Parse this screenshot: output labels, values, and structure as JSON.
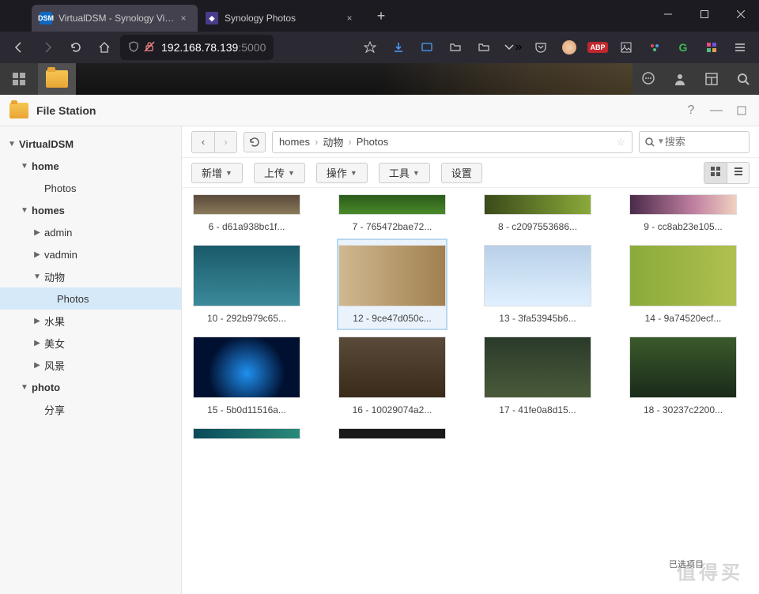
{
  "browser": {
    "tabs": [
      {
        "title": "VirtualDSM - Synology Virtua",
        "favicon_bg": "#1068bf",
        "favicon_txt": "DSM",
        "active": true
      },
      {
        "title": "Synology Photos",
        "favicon_bg": "#4a3a8a",
        "favicon_txt": "◆",
        "active": false
      }
    ],
    "url_host": "192.168.78.139",
    "url_port": ":5000"
  },
  "dsm_app": {
    "title": "File Station"
  },
  "tree": {
    "root": "VirtualDSM",
    "nodes": [
      {
        "label": "home",
        "depth": 1,
        "expanded": true,
        "children": true
      },
      {
        "label": "Photos",
        "depth": 2,
        "expanded": null,
        "children": false
      },
      {
        "label": "homes",
        "depth": 1,
        "expanded": true,
        "children": true
      },
      {
        "label": "admin",
        "depth": 2,
        "expanded": false,
        "children": true
      },
      {
        "label": "vadmin",
        "depth": 2,
        "expanded": false,
        "children": true
      },
      {
        "label": "动物",
        "depth": 2,
        "expanded": true,
        "children": true
      },
      {
        "label": "Photos",
        "depth": 3,
        "expanded": null,
        "children": false,
        "selected": true
      },
      {
        "label": "水果",
        "depth": 2,
        "expanded": false,
        "children": true
      },
      {
        "label": "美女",
        "depth": 2,
        "expanded": false,
        "children": true
      },
      {
        "label": "风景",
        "depth": 2,
        "expanded": false,
        "children": true
      },
      {
        "label": "photo",
        "depth": 1,
        "expanded": true,
        "children": true
      },
      {
        "label": "分享",
        "depth": 2,
        "expanded": null,
        "children": false
      }
    ]
  },
  "breadcrumb": {
    "parts": [
      "homes",
      "动物",
      "Photos"
    ]
  },
  "search": {
    "placeholder": "搜索"
  },
  "toolbar": {
    "new": "新增",
    "upload": "上传",
    "action": "操作",
    "tools": "工具",
    "settings": "设置"
  },
  "files": [
    {
      "name": "6 - d61a938bc1f...",
      "thumb": "t6",
      "partial": true
    },
    {
      "name": "7 - 765472bae72...",
      "thumb": "t7",
      "partial": true
    },
    {
      "name": "8 - c2097553686...",
      "thumb": "t8",
      "partial": true
    },
    {
      "name": "9 - cc8ab23e105...",
      "thumb": "t9",
      "partial": true
    },
    {
      "name": "10 - 292b979c65...",
      "thumb": "t10"
    },
    {
      "name": "12 - 9ce47d050c...",
      "thumb": "t12",
      "selected": true
    },
    {
      "name": "13 - 3fa53945b6...",
      "thumb": "t13"
    },
    {
      "name": "14 - 9a74520ecf...",
      "thumb": "t14"
    },
    {
      "name": "15 - 5b0d11516a...",
      "thumb": "t15"
    },
    {
      "name": "16 - 10029074a2...",
      "thumb": "t16"
    },
    {
      "name": "17 - 41fe0a8d15...",
      "thumb": "t17"
    },
    {
      "name": "18 - 30237c2200...",
      "thumb": "t18"
    },
    {
      "name": "",
      "thumb": "t19",
      "partial2": true
    },
    {
      "name": "",
      "thumb": "t20",
      "partial2": true
    }
  ],
  "status": "已选项目",
  "watermark": "值得买"
}
